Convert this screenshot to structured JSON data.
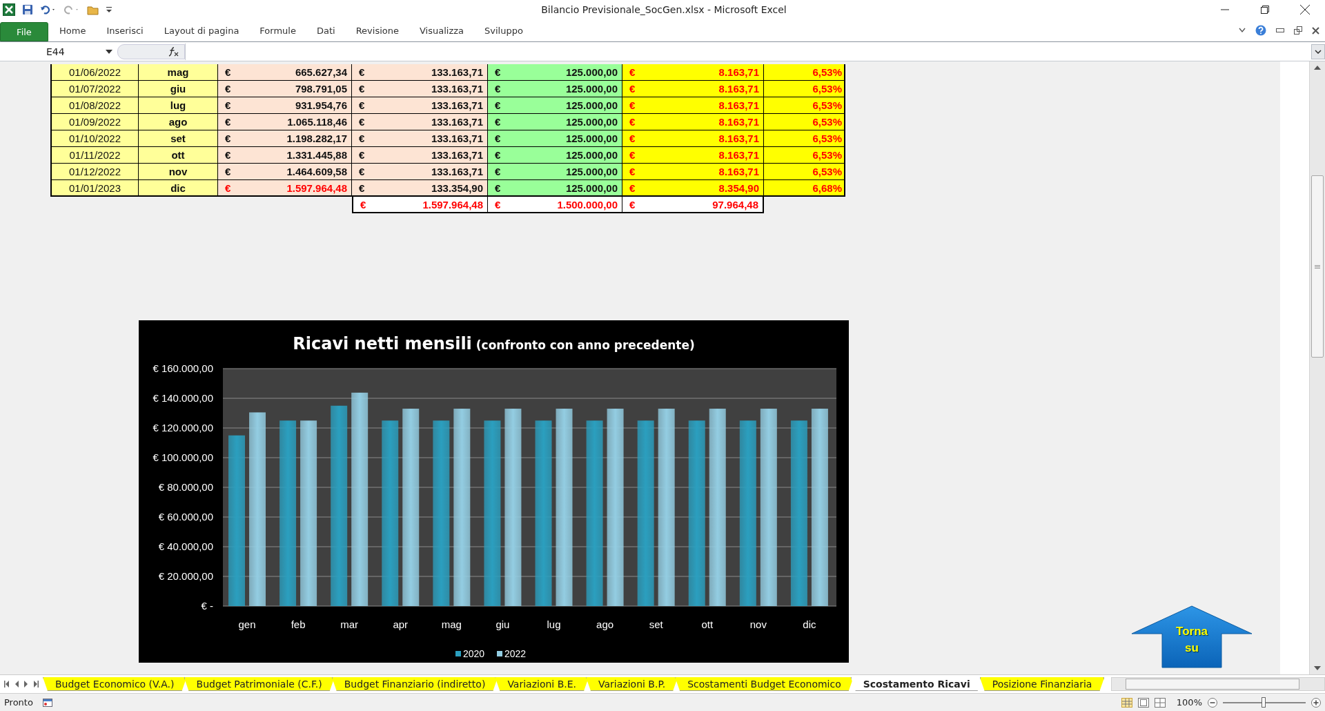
{
  "window": {
    "title": "Bilancio Previsionale_SocGen.xlsx  -  Microsoft Excel"
  },
  "ribbon": {
    "file_tab": "File",
    "tabs": [
      "Home",
      "Inserisci",
      "Layout di pagina",
      "Formule",
      "Dati",
      "Revisione",
      "Visualizza",
      "Sviluppo"
    ]
  },
  "formula_bar": {
    "name_box": "E44"
  },
  "table": {
    "rows": [
      {
        "date": "01/06/2022",
        "month": "mag",
        "cells": [
          {
            "symbol": "€",
            "value": "665.627,34",
            "alert": false
          },
          {
            "symbol": "€",
            "value": "133.163,71",
            "alert": false
          },
          {
            "symbol": "€",
            "value": "125.000,00",
            "alert": false
          },
          {
            "symbol": "€",
            "value": "8.163,71",
            "alert": true
          }
        ],
        "percent": "6,53%"
      },
      {
        "date": "01/07/2022",
        "month": "giu",
        "cells": [
          {
            "symbol": "€",
            "value": "798.791,05",
            "alert": false
          },
          {
            "symbol": "€",
            "value": "133.163,71",
            "alert": false
          },
          {
            "symbol": "€",
            "value": "125.000,00",
            "alert": false
          },
          {
            "symbol": "€",
            "value": "8.163,71",
            "alert": true
          }
        ],
        "percent": "6,53%"
      },
      {
        "date": "01/08/2022",
        "month": "lug",
        "cells": [
          {
            "symbol": "€",
            "value": "931.954,76",
            "alert": false
          },
          {
            "symbol": "€",
            "value": "133.163,71",
            "alert": false
          },
          {
            "symbol": "€",
            "value": "125.000,00",
            "alert": false
          },
          {
            "symbol": "€",
            "value": "8.163,71",
            "alert": true
          }
        ],
        "percent": "6,53%"
      },
      {
        "date": "01/09/2022",
        "month": "ago",
        "cells": [
          {
            "symbol": "€",
            "value": "1.065.118,46",
            "alert": false
          },
          {
            "symbol": "€",
            "value": "133.163,71",
            "alert": false
          },
          {
            "symbol": "€",
            "value": "125.000,00",
            "alert": false
          },
          {
            "symbol": "€",
            "value": "8.163,71",
            "alert": true
          }
        ],
        "percent": "6,53%"
      },
      {
        "date": "01/10/2022",
        "month": "set",
        "cells": [
          {
            "symbol": "€",
            "value": "1.198.282,17",
            "alert": false
          },
          {
            "symbol": "€",
            "value": "133.163,71",
            "alert": false
          },
          {
            "symbol": "€",
            "value": "125.000,00",
            "alert": false
          },
          {
            "symbol": "€",
            "value": "8.163,71",
            "alert": true
          }
        ],
        "percent": "6,53%"
      },
      {
        "date": "01/11/2022",
        "month": "ott",
        "cells": [
          {
            "symbol": "€",
            "value": "1.331.445,88",
            "alert": false
          },
          {
            "symbol": "€",
            "value": "133.163,71",
            "alert": false
          },
          {
            "symbol": "€",
            "value": "125.000,00",
            "alert": false
          },
          {
            "symbol": "€",
            "value": "8.163,71",
            "alert": true
          }
        ],
        "percent": "6,53%"
      },
      {
        "date": "01/12/2022",
        "month": "nov",
        "cells": [
          {
            "symbol": "€",
            "value": "1.464.609,58",
            "alert": false
          },
          {
            "symbol": "€",
            "value": "133.163,71",
            "alert": false
          },
          {
            "symbol": "€",
            "value": "125.000,00",
            "alert": false
          },
          {
            "symbol": "€",
            "value": "8.163,71",
            "alert": true
          }
        ],
        "percent": "6,53%"
      },
      {
        "date": "01/01/2023",
        "month": "dic",
        "cells": [
          {
            "symbol": "€",
            "value": "1.597.964,48",
            "alert": true
          },
          {
            "symbol": "€",
            "value": "133.354,90",
            "alert": false
          },
          {
            "symbol": "€",
            "value": "125.000,00",
            "alert": false
          },
          {
            "symbol": "€",
            "value": "8.354,90",
            "alert": true
          }
        ],
        "percent": "6,68%"
      }
    ],
    "totals": [
      {
        "symbol": "€",
        "value": "1.597.964,48",
        "alert": true
      },
      {
        "symbol": "€",
        "value": "1.500.000,00",
        "alert": true
      },
      {
        "symbol": "€",
        "value": "97.964,48",
        "alert": true
      }
    ]
  },
  "chart": {
    "chart_data": {
      "type": "bar",
      "title": "Ricavi netti mensili",
      "subtitle": "(confronto con anno precedente)",
      "categories": [
        "gen",
        "feb",
        "mar",
        "apr",
        "mag",
        "giu",
        "lug",
        "ago",
        "set",
        "ott",
        "nov",
        "dic"
      ],
      "series": [
        {
          "name": "2020",
          "color": "#2b9fbf",
          "values": [
            115000,
            125000,
            135000,
            125000,
            125000,
            125000,
            125000,
            125000,
            125000,
            125000,
            125000,
            125000
          ]
        },
        {
          "name": "2022",
          "color": "#93cde2",
          "values": [
            130500,
            125000,
            143800,
            133000,
            133000,
            133000,
            133000,
            133000,
            133000,
            133000,
            133000,
            133000
          ]
        }
      ],
      "grid": true,
      "legend": true,
      "ylim": [
        0,
        160000
      ],
      "yticks": [
        {
          "value": 0,
          "label": "€ -"
        },
        {
          "value": 20000,
          "label": "€ 20.000,00"
        },
        {
          "value": 40000,
          "label": "€ 40.000,00"
        },
        {
          "value": 60000,
          "label": "€ 60.000,00"
        },
        {
          "value": 80000,
          "label": "€ 80.000,00"
        },
        {
          "value": 100000,
          "label": "€ 100.000,00"
        },
        {
          "value": 120000,
          "label": "€ 120.000,00"
        },
        {
          "value": 140000,
          "label": "€ 140.000,00"
        },
        {
          "value": 160000,
          "label": "€ 160.000,00"
        }
      ]
    }
  },
  "back_button": {
    "label": "Torna su"
  },
  "sheet_tabs": [
    {
      "label": "Budget Economico (V.A.)",
      "selected": false
    },
    {
      "label": "Budget Patrimoniale (C.F.)",
      "selected": false
    },
    {
      "label": "Budget Finanziario (indiretto)",
      "selected": false
    },
    {
      "label": "Variazioni B.E.",
      "selected": false
    },
    {
      "label": "Variazioni B.P.",
      "selected": false
    },
    {
      "label": "Scostamenti Budget Economico",
      "selected": false
    },
    {
      "label": "Scostamento Ricavi",
      "selected": true
    },
    {
      "label": "Posizione Finanziaria",
      "selected": false
    }
  ],
  "status_bar": {
    "status": "Pronto",
    "zoom": "100%",
    "zoom_slider": {
      "level": 0.5
    }
  }
}
